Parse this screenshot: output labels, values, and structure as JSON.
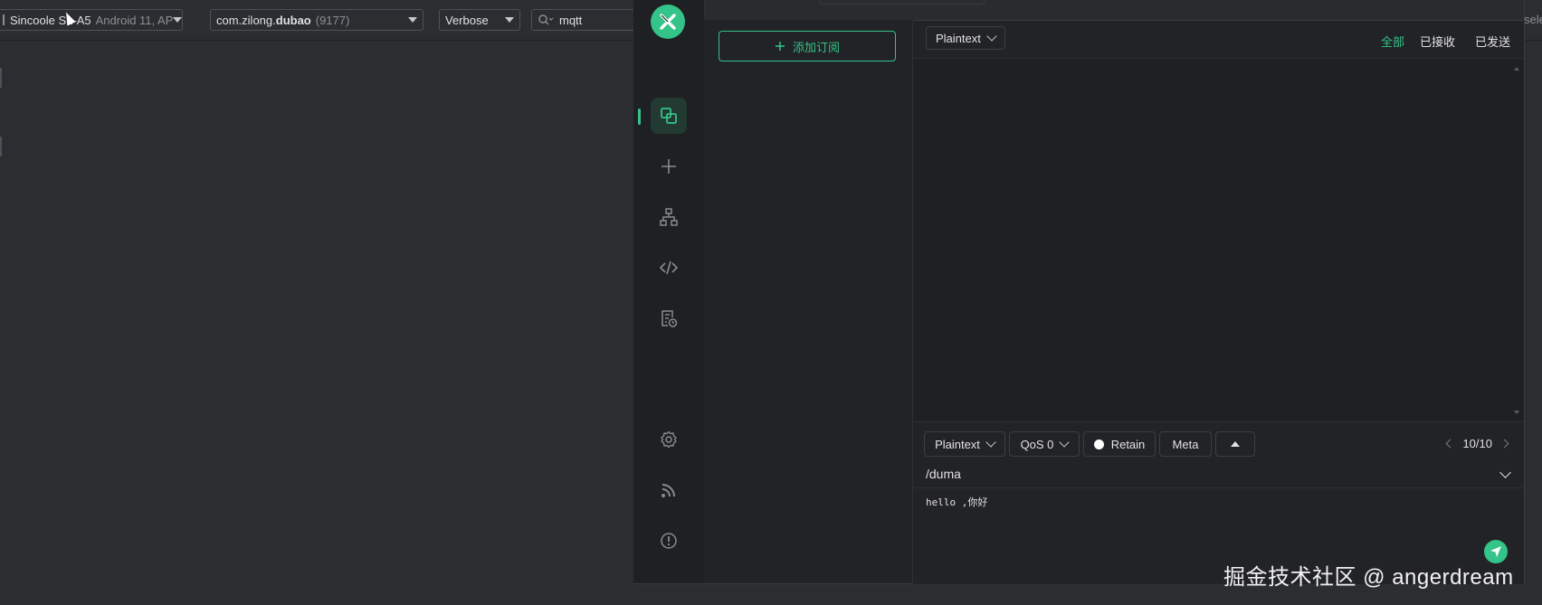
{
  "ide": {
    "device_name": "Sincoole S",
    "device_name_rest": "1-A5",
    "device_detail": "Android 11, AP",
    "process_prefix": "com.zilong.",
    "process_bold": "dubao",
    "process_pid": "(9177)",
    "log_level": "Verbose",
    "filter_query": "mqtt",
    "right_cut_text": "selec"
  },
  "mqttx": {
    "nav": {
      "items": [
        {
          "name": "connections",
          "icon": "connections-icon",
          "active": true
        },
        {
          "name": "new-connection",
          "icon": "plus-icon"
        },
        {
          "name": "topic-tree",
          "icon": "tree-icon"
        },
        {
          "name": "script",
          "icon": "code-icon"
        },
        {
          "name": "log",
          "icon": "log-icon"
        },
        {
          "name": "settings",
          "icon": "gear-icon"
        },
        {
          "name": "subscribe",
          "icon": "rss-icon"
        },
        {
          "name": "about",
          "icon": "info-icon"
        }
      ]
    },
    "subscriptions": {
      "add_label": "添加订阅"
    },
    "messages": {
      "format": "Plaintext",
      "filters": [
        "全部",
        "已接收",
        "已发送"
      ],
      "active_filter": 0
    },
    "publish": {
      "format": "Plaintext",
      "qos": "QoS 0",
      "retain_label": "Retain",
      "meta_label": "Meta",
      "pager": "10/10",
      "topic": "/duma",
      "payload": "hello ,你好"
    }
  },
  "watermark": "掘金技术社区 @ angerdream",
  "colors": {
    "accent": "#34c388",
    "ide_bg": "#2b2d30",
    "app_bg": "#222326"
  }
}
